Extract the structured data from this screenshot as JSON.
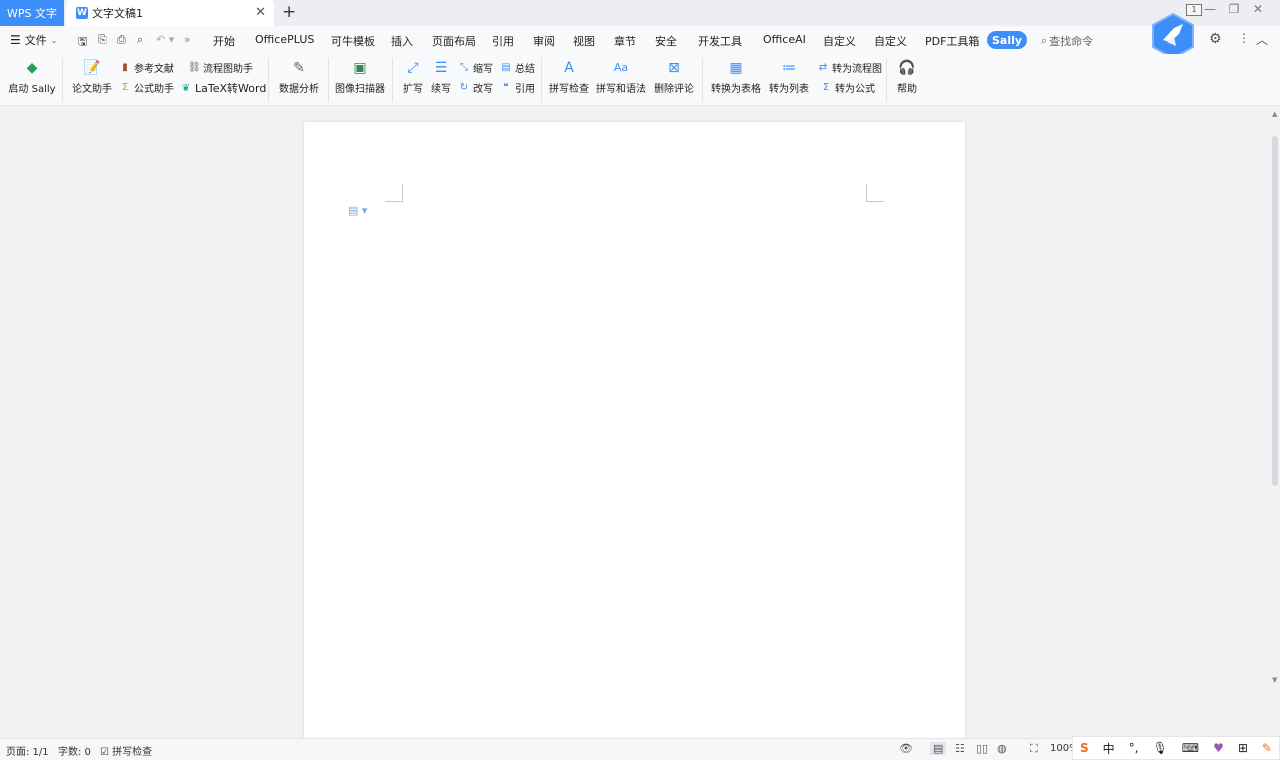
{
  "titlebar": {
    "app_tab": "WPS 文字",
    "doc_tab": "文字文稿1",
    "doc_tab_icon": "W",
    "close_glyph": "✕",
    "new_tab_glyph": "+",
    "window_number": "1"
  },
  "menubar": {
    "file": "文件",
    "tabs": [
      "开始",
      "OfficePLUS",
      "可牛模板",
      "插入",
      "页面布局",
      "引用",
      "审阅",
      "视图",
      "章节",
      "安全",
      "开发工具",
      "OfficeAI",
      "自定义",
      "自定义",
      "PDF工具箱"
    ],
    "active_tab": "Sally",
    "search_placeholder": "查找命令"
  },
  "ribbon": {
    "start_sally": "启动 Sally",
    "paper_assistant": "论文助手",
    "references": "参考文献",
    "formula_assistant": "公式助手",
    "flowchart_assistant": "流程图助手",
    "latex_to_word": "LaTeX转Word",
    "data_analysis": "数据分析",
    "image_scanner": "图像扫描器",
    "expand": "扩写",
    "continue": "续写",
    "shorten": "缩写",
    "rewrite": "改写",
    "summarize": "总结",
    "cite": "引用",
    "spell_check": "拼写检查",
    "spell_grammar": "拼写和语法",
    "delete_comments": "删除评论",
    "to_table": "转换为表格",
    "to_list": "转为列表",
    "to_flowchart": "转为流程图",
    "to_formula": "转为公式",
    "help": "帮助"
  },
  "statusbar": {
    "page": "页面: 1/1",
    "word_count": "字数: 0",
    "spell_check": "拼写检查",
    "zoom": "100%"
  },
  "ime": {
    "lang": "中"
  },
  "colors": {
    "accent": "#3d8ef8",
    "ribbon_bg": "#f8f9fa",
    "canvas_bg": "#f1f2f4"
  }
}
